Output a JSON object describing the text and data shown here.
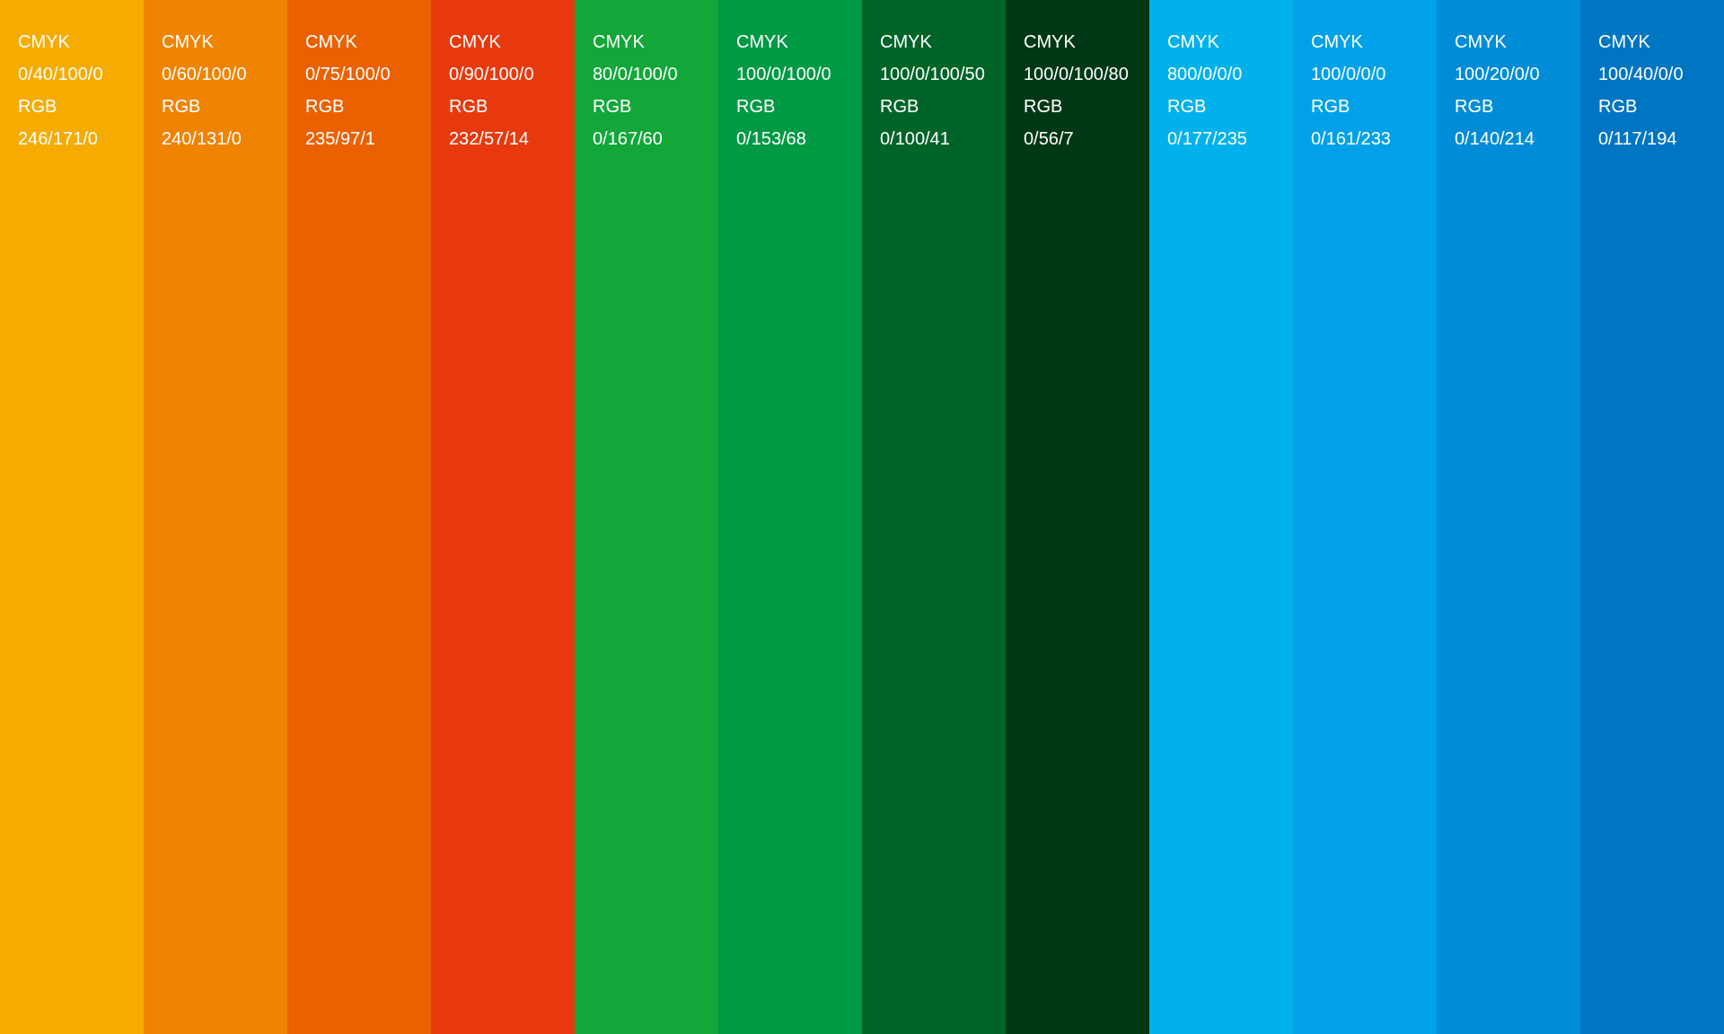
{
  "swatches": [
    {
      "color": "#f6ab00",
      "cmyk_label": "CMYK",
      "cmyk": "0/40/100/0",
      "rgb_label": "RGB",
      "rgb": "246/171/0"
    },
    {
      "color": "#f08300",
      "cmyk_label": "CMYK",
      "cmyk": "0/60/100/0",
      "rgb_label": "RGB",
      "rgb": "240/131/0"
    },
    {
      "color": "#eb6101",
      "cmyk_label": "CMYK",
      "cmyk": "0/75/100/0",
      "rgb_label": "RGB",
      "rgb": "235/97/1"
    },
    {
      "color": "#e8390e",
      "cmyk_label": "CMYK",
      "cmyk": "0/90/100/0",
      "rgb_label": "RGB",
      "rgb": "232/57/14"
    },
    {
      "color": "#13a73a",
      "cmyk_label": "CMYK",
      "cmyk": "80/0/100/0",
      "rgb_label": "RGB",
      "rgb": "0/167/60"
    },
    {
      "color": "#009944",
      "cmyk_label": "CMYK",
      "cmyk": "100/0/100/0",
      "rgb_label": "RGB",
      "rgb": "0/153/68"
    },
    {
      "color": "#006429",
      "cmyk_label": "CMYK",
      "cmyk": "100/0/100/50",
      "rgb_label": "RGB",
      "rgb": "0/100/41"
    },
    {
      "color": "#003815",
      "cmyk_label": "CMYK",
      "cmyk": "100/0/100/80",
      "rgb_label": "RGB",
      "rgb": "0/56/7"
    },
    {
      "color": "#00b1eb",
      "cmyk_label": "CMYK",
      "cmyk": "800/0/0/0",
      "rgb_label": "RGB",
      "rgb": "0/177/235"
    },
    {
      "color": "#00a1e9",
      "cmyk_label": "CMYK",
      "cmyk": "100/0/0/0",
      "rgb_label": "RGB",
      "rgb": "0/161/233"
    },
    {
      "color": "#008cd6",
      "cmyk_label": "CMYK",
      "cmyk": "100/20/0/0",
      "rgb_label": "RGB",
      "rgb": "0/140/214"
    },
    {
      "color": "#0075c2",
      "cmyk_label": "CMYK",
      "cmyk": "100/40/0/0",
      "rgb_label": "RGB",
      "rgb": "0/117/194"
    }
  ]
}
